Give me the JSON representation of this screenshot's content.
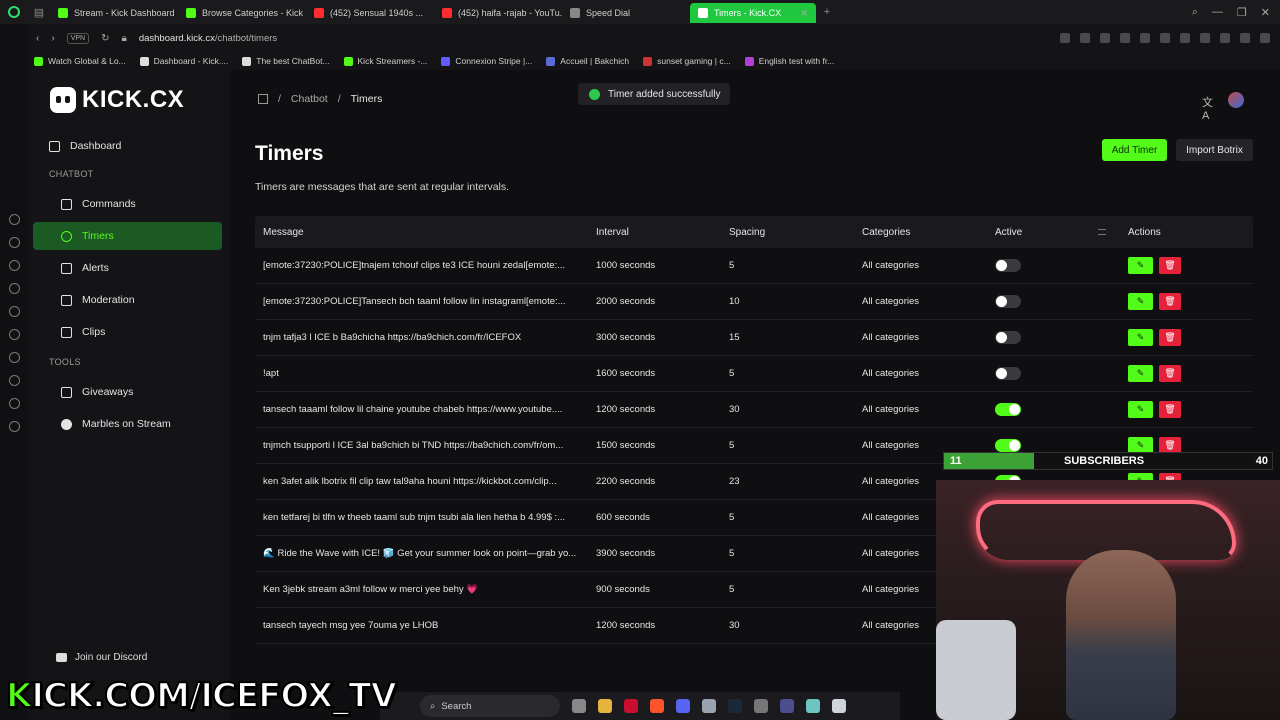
{
  "browser": {
    "tabs": [
      {
        "title": "Stream - Kick Dashboard",
        "color": "#53fc18"
      },
      {
        "title": "Browse Categories - Kick",
        "color": "#53fc18"
      },
      {
        "title": "(452) Sensual 1940s ...",
        "color": "#ff2d2d"
      },
      {
        "title": "(452) haifa -rajab - YouTu...",
        "color": "#ff2d2d"
      },
      {
        "title": "Speed Dial",
        "color": "#888888"
      },
      {
        "title": "Timers - Kick.CX",
        "color": "#ffffff"
      }
    ],
    "url_domain": "dashboard.kick.cx",
    "url_path": "/chatbot/timers",
    "vpn_label": "VPN",
    "bookmarks": [
      "Watch Global & Lo...",
      "Dashboard - Kick....",
      "The best ChatBot...",
      "Kick Streamers -...",
      "Connexion Stripe |...",
      "Accueil | Bakchich",
      "sunset gaming | c...",
      "English test with fr..."
    ]
  },
  "sidebar": {
    "logo_text": "KICK.CX",
    "dashboard": "Dashboard",
    "section_chatbot": "CHATBOT",
    "items": [
      "Commands",
      "Timers",
      "Alerts",
      "Moderation",
      "Clips"
    ],
    "section_tools": "TOOLS",
    "tools": [
      "Giveaways",
      "Marbles on Stream"
    ],
    "discord": "Join our Discord"
  },
  "breadcrumb": {
    "chatbot": "Chatbot",
    "current": "Timers"
  },
  "toast": "Timer added successfully",
  "page": {
    "title": "Timers",
    "subtitle": "Timers are messages that are sent at regular intervals.",
    "add_button": "Add Timer",
    "import_button": "Import Botrix"
  },
  "table": {
    "headers": [
      "Message",
      "Interval",
      "Spacing",
      "Categories",
      "Active",
      "Actions"
    ],
    "rows": [
      {
        "message": "[emote:37230:POLICE]tnajem tchouf clips te3 ICE houni zedal[emote:...",
        "interval": "1000 seconds",
        "spacing": "5",
        "categories": "All categories",
        "active": false
      },
      {
        "message": "[emote:37230:POLICE]Tansech bch taaml follow lin instagraml[emote:...",
        "interval": "2000 seconds",
        "spacing": "10",
        "categories": "All categories",
        "active": false
      },
      {
        "message": "tnjm tafja3 l ICE b Ba9chicha https://ba9chich.com/fr/ICEFOX",
        "interval": "3000 seconds",
        "spacing": "15",
        "categories": "All categories",
        "active": false
      },
      {
        "message": "!apt",
        "interval": "1600 seconds",
        "spacing": "5",
        "categories": "All categories",
        "active": false
      },
      {
        "message": "tansech taaaml follow lil chaine youtube chabeb https://www.youtube....",
        "interval": "1200 seconds",
        "spacing": "30",
        "categories": "All categories",
        "active": true
      },
      {
        "message": "tnjmch tsupporti l ICE 3al ba9chich bi TND https://ba9chich.com/fr/om...",
        "interval": "1500 seconds",
        "spacing": "5",
        "categories": "All categories",
        "active": true
      },
      {
        "message": "ken 3afet alik lbotrix fil clip taw tal9aha houni https://kickbot.com/clip...",
        "interval": "2200 seconds",
        "spacing": "23",
        "categories": "All categories",
        "active": true
      },
      {
        "message": "ken tetfarej bi tlfn w theeb taaml sub tnjm tsubi ala lien hetha b 4.99$ :...",
        "interval": "600 seconds",
        "spacing": "5",
        "categories": "All categories",
        "active": true
      },
      {
        "message": "🌊 Ride the Wave with ICE! 🧊 Get your summer look on point—grab yo...",
        "interval": "3900 seconds",
        "spacing": "5",
        "categories": "All categories",
        "active": true
      },
      {
        "message": "Ken 3jebk stream a3ml follow w merci yee behy 💗",
        "interval": "900 seconds",
        "spacing": "5",
        "categories": "All categories",
        "active": true
      },
      {
        "message": "tansech tayech msg yee 7ouma ye LHOB",
        "interval": "1200 seconds",
        "spacing": "30",
        "categories": "All categories",
        "active": true
      }
    ]
  },
  "overlay": {
    "subs_current": "11",
    "subs_label": "SUBSCRIBERS",
    "subs_goal": "40",
    "subs_progress": 0.275,
    "brand": "KICK.COM/ICEFOX_TV",
    "taskbar_search": "Search"
  },
  "colors": {
    "accent": "#53fc18",
    "danger": "#e5213b",
    "active_nav_bg": "#1c5a24"
  }
}
